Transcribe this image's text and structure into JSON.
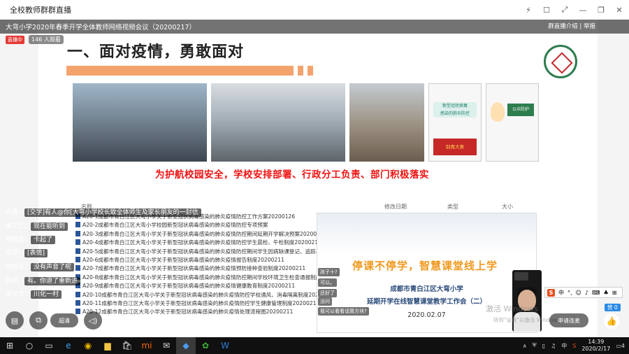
{
  "window": {
    "title": "全校教师群群直播",
    "controls": [
      "⚡",
      "☐",
      "⤢",
      "—",
      "❐",
      "✕"
    ]
  },
  "meeting": {
    "title": "大弯小学2020年春季开学全体教师网络视频会议（20200217）",
    "info_label": "群直播介绍",
    "report_label": "举报",
    "live_badge": "直播中",
    "viewer_count": "146 人观看"
  },
  "slide": {
    "heading": "一、面对疫情，勇敢面对",
    "caption": "为护航校园安全，学校安排部署、行政分工负责、部门积极落实",
    "photo4_lines": [
      "新型冠状病毒",
      "感染的肺炎防控",
      "健康知识",
      "别再大意"
    ],
    "photo5_lines": [
      "公众防护",
      "指南"
    ]
  },
  "file_table": {
    "headers": [
      "名称",
      "修改日期",
      "类型",
      "大小"
    ],
    "rows": [
      "A20-1成都市青白江区大弯小学关于新型冠状病毒感染的肺炎疫情防控工作方案20200126",
      "A20-2成都市青白江区大弯小学校园新型冠状病毒感染的肺炎疫情防控专项预案",
      "A20-3成都市青白江区大弯小学关于新型冠状病毒感染的肺炎疫情防控期间延期开学解决预案20200211",
      "A20-4成都市青白江区大弯小学关于新型冠状病毒感染的肺炎疫情防控学生晨检、午检制度20200211",
      "A20-5成都市青白江区大弯小学关于新型冠状病毒感染的肺炎疫情防控期间学生因病缺课登记、追踪、",
      "A20-6成都市青白江区大弯小学关于新型冠状病毒感染的肺炎疫情报告制度20200211",
      "A20-7成都市青白江区大弯小学关于新型冠状病毒感染的肺炎疫情预防接种查验制度20200211",
      "A20-8成都市青白江区大弯小学关于新型冠状病毒感染的肺炎疫情防控期间学校环境卫生检查通报制度",
      "A20-9成都市青白江区大弯小学关于新型冠状病毒感染的肺炎疫情健康教育制度20200211",
      "A20-10成都市青白江区大弯小学关于新型冠状病毒感染的肺炎疫情防控学校通风、消毒隔离制度20200211",
      "A20-11成都市青白江区大弯小学关于新型冠状病毒感染的肺炎疫情防控学生健康管理制度20200211",
      "A20-12成都市青白江区大弯小学关于新型冠状病毒感染的肺炎疫情处理流程图20200211"
    ]
  },
  "video": {
    "title": "停课不停学，智慧课堂线上学",
    "org": "成都市青白江区大弯小学",
    "subtitle": "延期开学在线智慧课堂教学工作会（二）",
    "date": "2020.02.07"
  },
  "video_chat": [
    "孩子十?",
    "可以。",
    "还好了",
    "没问",
    "我可以看看话筒方块?"
  ],
  "chat": [
    {
      "name": "向勇",
      "msg": "[交学]有人@你[大弯小学校长致全体师生及家长朋友的一封信"
    },
    {
      "name": "黄江仁",
      "msg": "现在能听到"
    },
    {
      "name": "钟佩芸",
      "msg": "卡起了"
    },
    {
      "name": "何萍",
      "msg": "[表情]"
    },
    {
      "name": "钟佩芸",
      "msg": "没有声音了呢"
    },
    {
      "name": "杨华",
      "msg": "有。你退了重新进"
    },
    {
      "name": "黄文亮",
      "msg": "川化一村"
    }
  ],
  "controls": {
    "mic_label": "超清",
    "connect_label": "申请连麦",
    "praise_label": "赞 0"
  },
  "watermark": {
    "line1": "激活 Windows",
    "line2": "转到\"设置\"以激活 Windows。"
  },
  "ime": {
    "lang": "中"
  },
  "taskbar": {
    "time": "14:39",
    "date": "2020/2/17",
    "lang": "中",
    "notif_count": "4"
  }
}
